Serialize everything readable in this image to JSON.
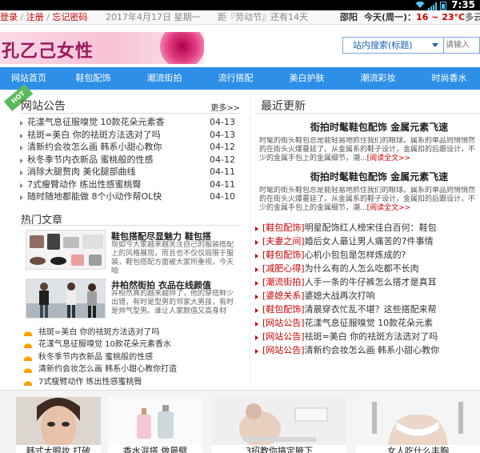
{
  "status_bar": {
    "time": "7:35"
  },
  "topbar": {
    "login": "登录",
    "register": "注册",
    "forgot": "忘记密码",
    "date": "2017年4月17日 星期一",
    "countdown": "距『劳动节』还有14天",
    "city": "邵阳",
    "weather_prefix": "今天(周一)：",
    "temp": "16 ~ 23°C",
    "condition": "多云"
  },
  "header": {
    "logo_text": "孔乙己女性",
    "search_type": "站内搜索(标题)",
    "search_placeholder": "请输入"
  },
  "nav": [
    "网站首页",
    "鞋包配饰",
    "潮流街拍",
    "流行搭配",
    "美白护肤",
    "潮流彩妆",
    "时尚香水"
  ],
  "notice": {
    "badge": "HOT",
    "title": "网站公告",
    "more": "更多>>",
    "items": [
      {
        "text": "花漾气息征服嗅觉 10款花朵元素香",
        "date": "04-13"
      },
      {
        "text": "祛斑=美白 你的祛斑方法选对了吗",
        "date": "04-13"
      },
      {
        "text": "清新约会妆怎么画 韩系小甜心教你",
        "date": "04-12"
      },
      {
        "text": "秋冬季节内衣新品 蜜桃般的性感",
        "date": "04-12"
      },
      {
        "text": "消除大腿赘肉 美化腿部曲线",
        "date": "04-11"
      },
      {
        "text": "7式瘦臂动作 练出性感蜜桃臀",
        "date": "04-11"
      },
      {
        "text": "随时随地都能做 8个小动作帮OL快",
        "date": "04-10"
      }
    ]
  },
  "hot": {
    "title": "热门文章",
    "articles": [
      {
        "title": "鞋包搭配尽显魅力 鞋包搭",
        "desc": "现如今大家越来越关注自己的服装搭配上的风格展现，而且也不仅仅局限于服装，鞋包搭配方面被大家所重视，今天咱"
      },
      {
        "title": "井柏然街拍 衣品在线颜值",
        "desc": "井柏然真的越来越帅了，他的穿搭鲜少出错，有时是型男的邻家大男孩，有时是帅气型男。谁让人家颜值又高身材"
      }
    ],
    "items": [
      "祛斑=美白 你的祛斑方法选对了吗",
      "花漾气息征服嗅觉 10款花朵元素香水",
      "秋冬季节内衣新品 蜜桃般的性感",
      "清新约会妆怎么画 韩系小甜心教你打造",
      "7式瘦臂动作 练出性感蜜桃臀"
    ]
  },
  "latest": {
    "title": "最近更新",
    "features": [
      {
        "title": "街拍时髦鞋包配饰 金属元素飞速",
        "desc": "时髦的街头鞋包总是能轻易地抓住我们的眼球。属系的单品则悄悄然的在街头火爆蔓延了。从金属系的鞋子设计，金属扣的后跟设计，不少的金属手包上的金属细节，潮...",
        "read_all": "[阅读全文>>"
      },
      {
        "title": "街拍时髦鞋包配饰 金属元素飞速",
        "desc": "时髦的街头鞋包总是能轻易地抓住我们的眼球。属系的单品则悄悄然的在街头火爆蔓延了。从金属系的鞋子设计，金属扣的后跟设计，不少的金属手包上的金属细节，潮...",
        "read_all": "[阅读全文>>"
      }
    ],
    "items": [
      {
        "cat": "[鞋包配饰]",
        "text": "明星配饰红人榜宋佳白百何：鞋包"
      },
      {
        "cat": "[夫妻之间]",
        "text": "婚后女人最让男人痛苦的7件事情"
      },
      {
        "cat": "[鞋包配饰]",
        "text": "心机小包包是怎样炼成的?"
      },
      {
        "cat": "[减肥心得]",
        "text": "为什么有的人怎么吃都不长肉"
      },
      {
        "cat": "[潮流街拍]",
        "text": "人手一条的牛仔裤怎么搭才是真耳"
      },
      {
        "cat": "[婆媳关系]",
        "text": "婆媳大战再次打响"
      },
      {
        "cat": "[鞋包配饰]",
        "text": "清晨穿衣忙乱不堪？这些搭配来帮"
      },
      {
        "cat": "[网站公告]",
        "text": "花漾气息征服嗅觉 10款花朵元素"
      },
      {
        "cat": "[网站公告]",
        "text": "祛斑=美白 你的祛斑方法选对了吗"
      },
      {
        "cat": "[网站公告]",
        "text": "清新约会妆怎么画 韩系小甜心教你"
      }
    ]
  },
  "gallery": [
    {
      "caption": "韩式大眼妆 打破"
    },
    {
      "caption": "香水混搭 做最劈"
    },
    {
      "caption": "3招教你搞定腋下"
    },
    {
      "caption": "女人吃什么丰胸"
    }
  ]
}
